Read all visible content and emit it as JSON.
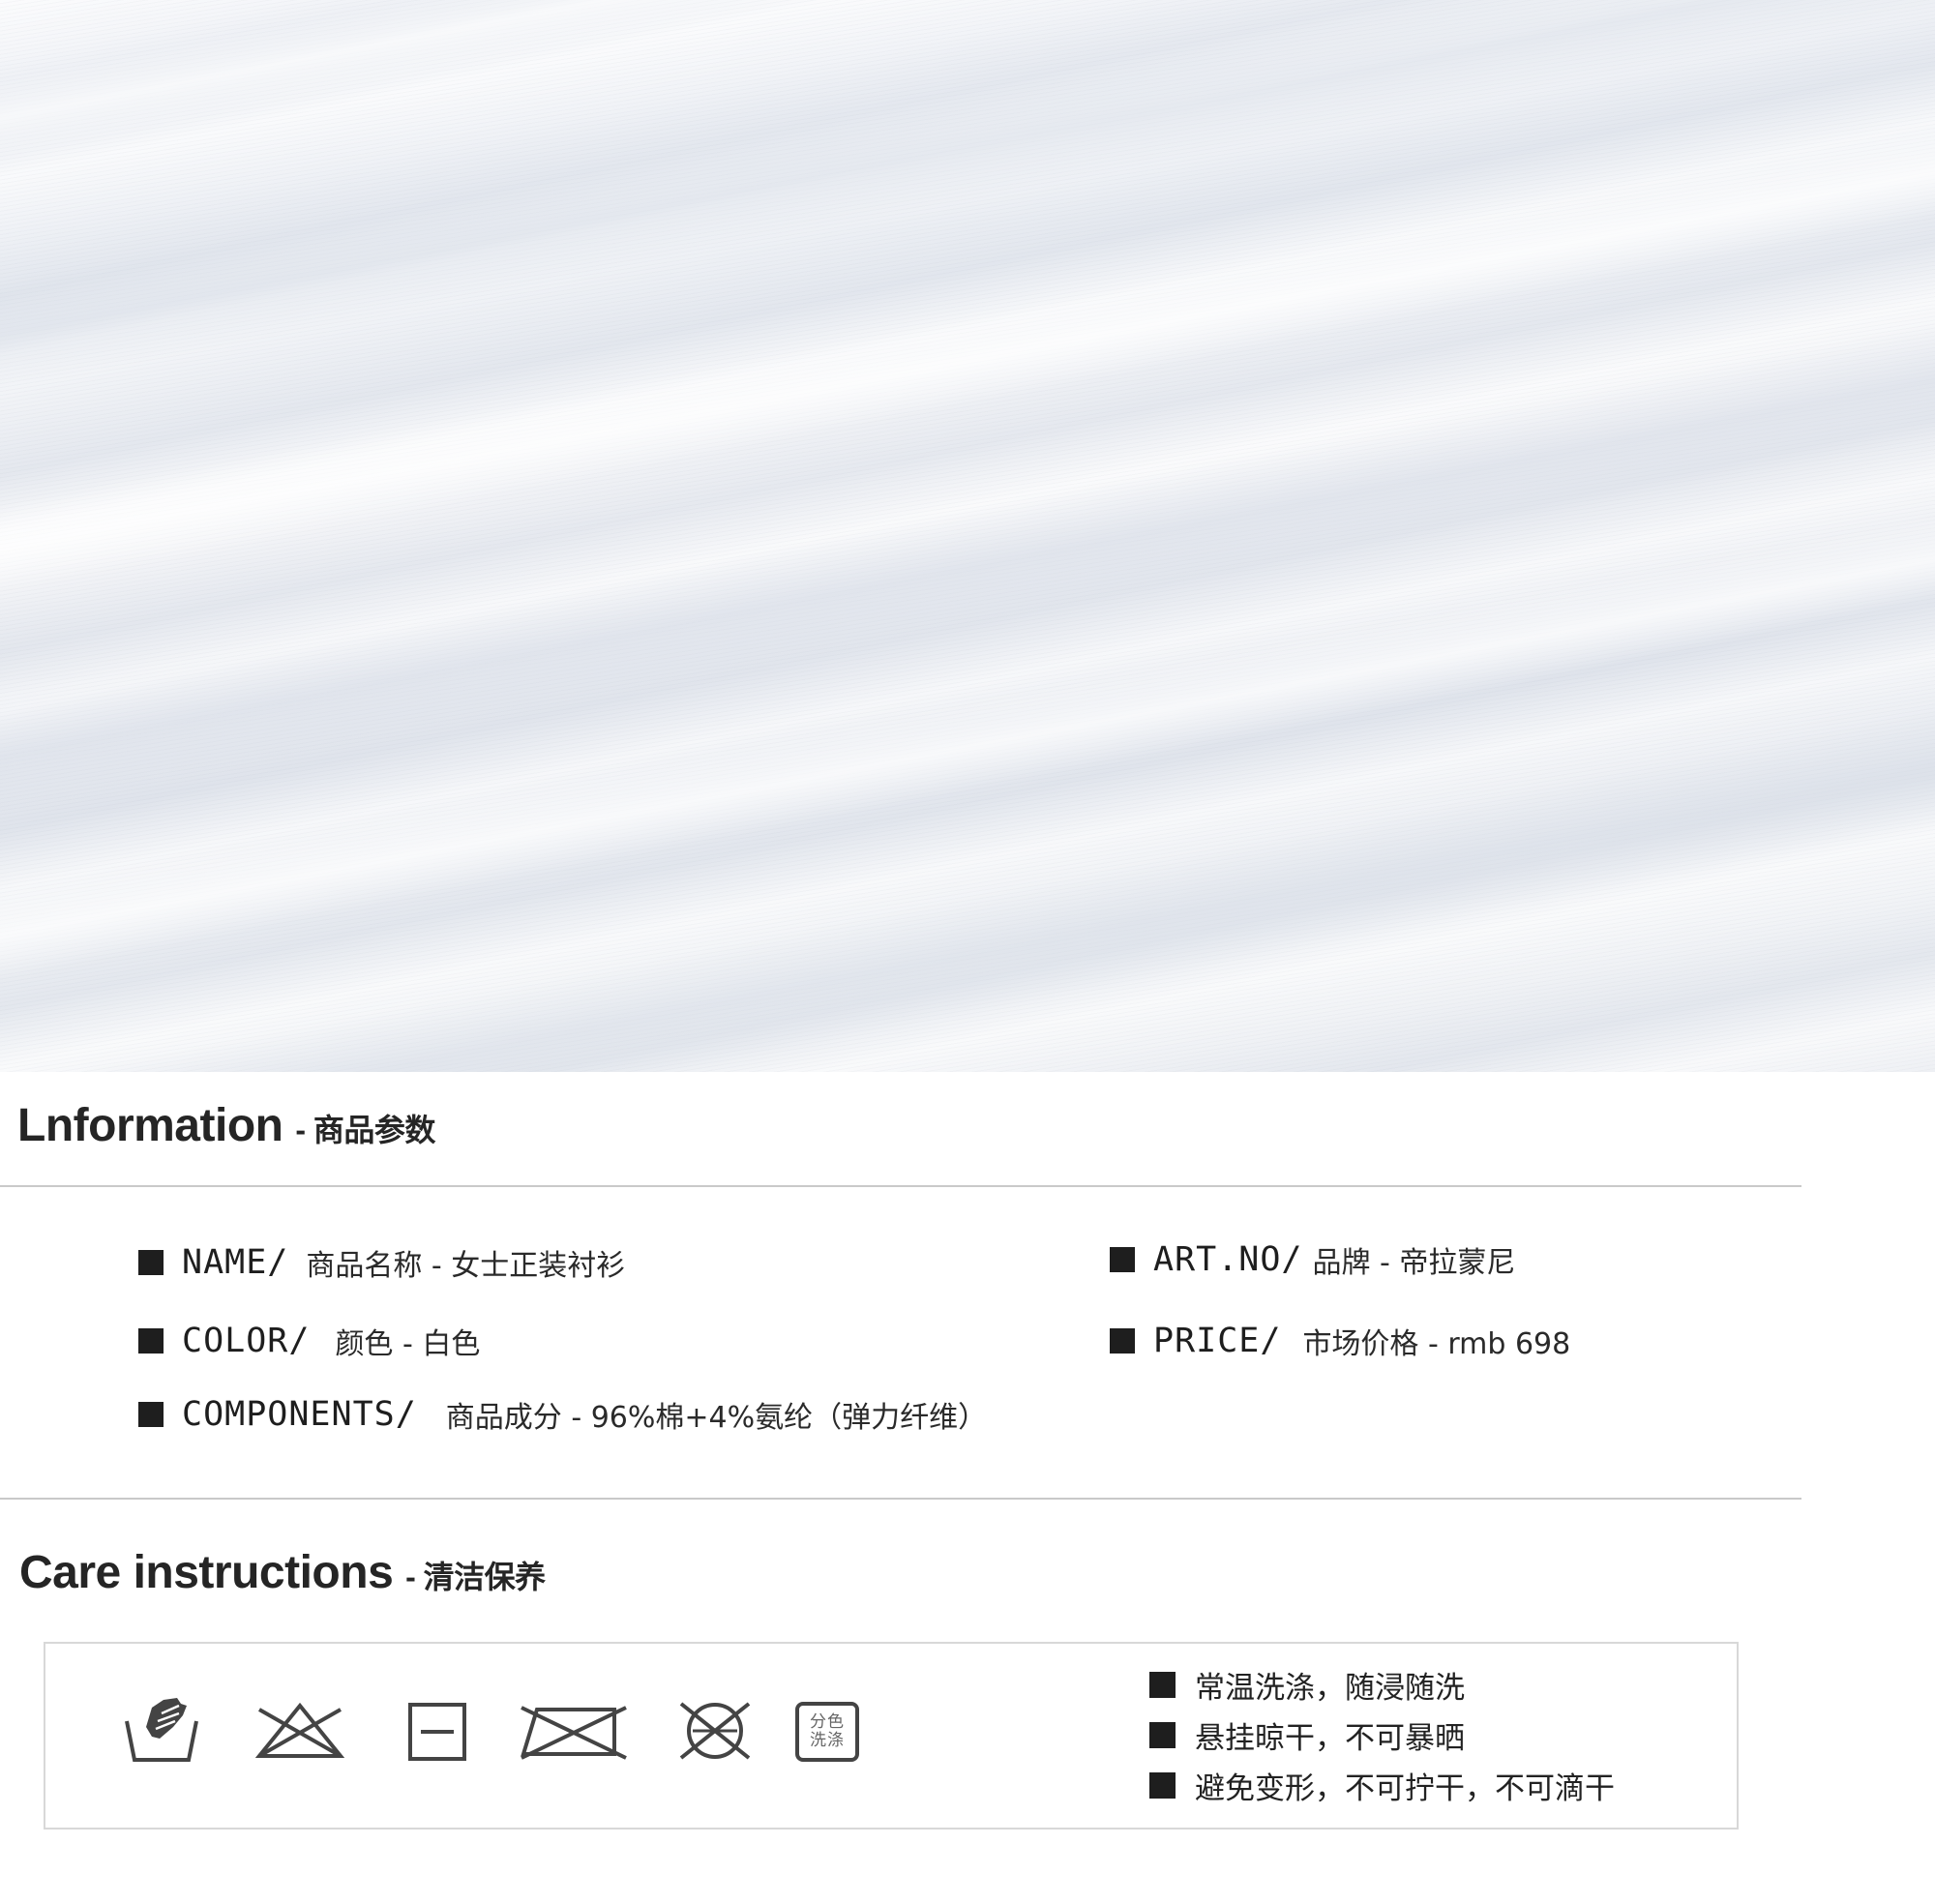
{
  "information": {
    "title": "Lnformation",
    "title_sub": "- 商品参数",
    "items": [
      {
        "label": "NAME/",
        "value": "商品名称 - 女士正装衬衫"
      },
      {
        "label": "ART.NO/",
        "value": "品牌 - 帝拉蒙尼"
      },
      {
        "label": "COLOR/",
        "value": "颜色 - 白色"
      },
      {
        "label": "PRICE/",
        "value": "市场价格 - rmb 698"
      },
      {
        "label": "COMPONENTS/",
        "value": "商品成分 - 96%棉+4%氨纶（弹力纤维）"
      }
    ]
  },
  "care": {
    "title": "Care instructions",
    "title_sub": "- 清洁保养",
    "icons": [
      {
        "name": "hand-wash-icon"
      },
      {
        "name": "do-not-bleach-icon"
      },
      {
        "name": "dry-flat-icon"
      },
      {
        "name": "do-not-iron-icon"
      },
      {
        "name": "do-not-dry-clean-icon"
      },
      {
        "name": "wash-separately-icon",
        "text_line1": "分色",
        "text_line2": "洗涤"
      }
    ],
    "notes": [
      "常温洗涤，随浸随洗",
      "悬挂晾干，不可暴晒",
      "避免变形，不可拧干，不可滴干"
    ]
  },
  "colors": {
    "text": "#222222",
    "rule": "#c9c9c9",
    "fabric": "#eef0f4",
    "square": "#1e1e1e"
  }
}
